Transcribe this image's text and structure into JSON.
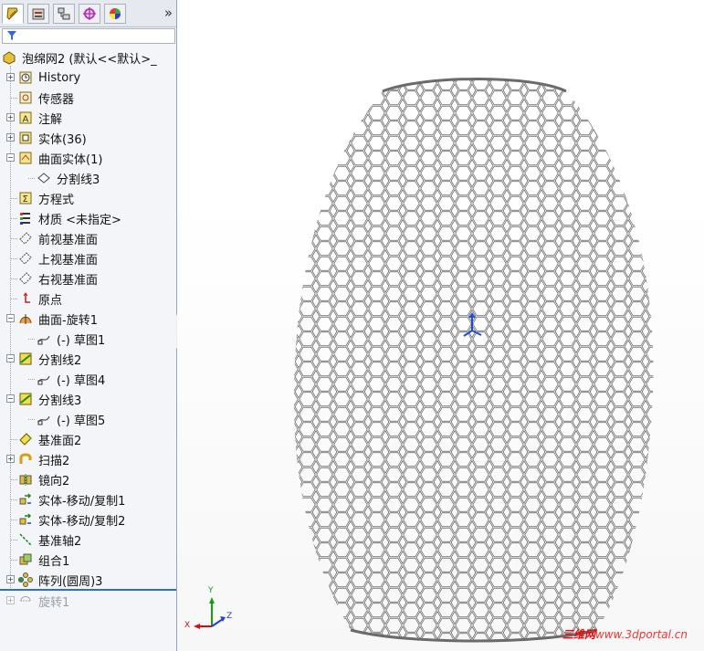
{
  "panel": {
    "tabs": [
      "feature-manager-icon",
      "property-manager-icon",
      "configuration-manager-icon",
      "dimxpert-icon",
      "display-manager-icon"
    ],
    "expand_glyph": "»",
    "root_label": "泡绵网2 (默认<<默认>_",
    "items": [
      {
        "label": "History",
        "icon": "history-icon",
        "indent": 1,
        "expand": true
      },
      {
        "label": "传感器",
        "icon": "sensor-icon",
        "indent": 1,
        "expand": false
      },
      {
        "label": "注解",
        "icon": "annotation-icon",
        "indent": 1,
        "expand": true
      },
      {
        "label": "实体(36)",
        "icon": "solid-bodies-icon",
        "indent": 1,
        "expand": true
      },
      {
        "label": "曲面实体(1)",
        "icon": "surface-bodies-icon",
        "indent": 1,
        "expand": true,
        "open": true
      },
      {
        "label": "分割线3",
        "icon": "split-line-icon",
        "indent": 2,
        "expand": false
      },
      {
        "label": "方程式",
        "icon": "equation-icon",
        "indent": 1,
        "expand": false
      },
      {
        "label": "材质 <未指定>",
        "icon": "material-icon",
        "indent": 1,
        "expand": false
      },
      {
        "label": "前视基准面",
        "icon": "plane-icon",
        "indent": 1,
        "expand": false
      },
      {
        "label": "上视基准面",
        "icon": "plane-icon",
        "indent": 1,
        "expand": false
      },
      {
        "label": "右视基准面",
        "icon": "plane-icon",
        "indent": 1,
        "expand": false
      },
      {
        "label": "原点",
        "icon": "origin-icon",
        "indent": 1,
        "expand": false
      },
      {
        "label": "曲面-旋转1",
        "icon": "revolve-surface-icon",
        "indent": 1,
        "expand": true,
        "open": true
      },
      {
        "label": "(-) 草图1",
        "icon": "sketch-icon",
        "indent": 2,
        "expand": false
      },
      {
        "label": "分割线2",
        "icon": "split-line-feature-icon",
        "indent": 1,
        "expand": true,
        "open": true
      },
      {
        "label": "(-) 草图4",
        "icon": "sketch-icon",
        "indent": 2,
        "expand": false
      },
      {
        "label": "分割线3",
        "icon": "split-line-feature-icon",
        "indent": 1,
        "expand": true,
        "open": true
      },
      {
        "label": "(-) 草图5",
        "icon": "sketch-icon",
        "indent": 2,
        "expand": false
      },
      {
        "label": "基准面2",
        "icon": "ref-plane-icon",
        "indent": 1,
        "expand": false
      },
      {
        "label": "扫描2",
        "icon": "sweep-icon",
        "indent": 1,
        "expand": true
      },
      {
        "label": "镜向2",
        "icon": "mirror-icon",
        "indent": 1,
        "expand": false
      },
      {
        "label": "实体-移动/复制1",
        "icon": "move-copy-icon",
        "indent": 1,
        "expand": false
      },
      {
        "label": "实体-移动/复制2",
        "icon": "move-copy-icon",
        "indent": 1,
        "expand": false
      },
      {
        "label": "基准轴2",
        "icon": "axis-icon",
        "indent": 1,
        "expand": false
      },
      {
        "label": "组合1",
        "icon": "combine-icon",
        "indent": 1,
        "expand": false
      },
      {
        "label": "阵列(圆周)3",
        "icon": "circular-pattern-icon",
        "indent": 1,
        "expand": true
      }
    ],
    "suppressed_item": {
      "label": "旋转1",
      "icon": "revolve-icon"
    }
  },
  "viewport": {
    "triad": {
      "x_label": "X",
      "y_label": "Y",
      "z_label": "Z"
    },
    "watermark_cn": "三维网",
    "watermark_url": "www.3dportal.cn"
  },
  "colors": {
    "accent": "#2f6fc6",
    "mesh": "#6b6b6b",
    "watermark": "#ff3030"
  }
}
